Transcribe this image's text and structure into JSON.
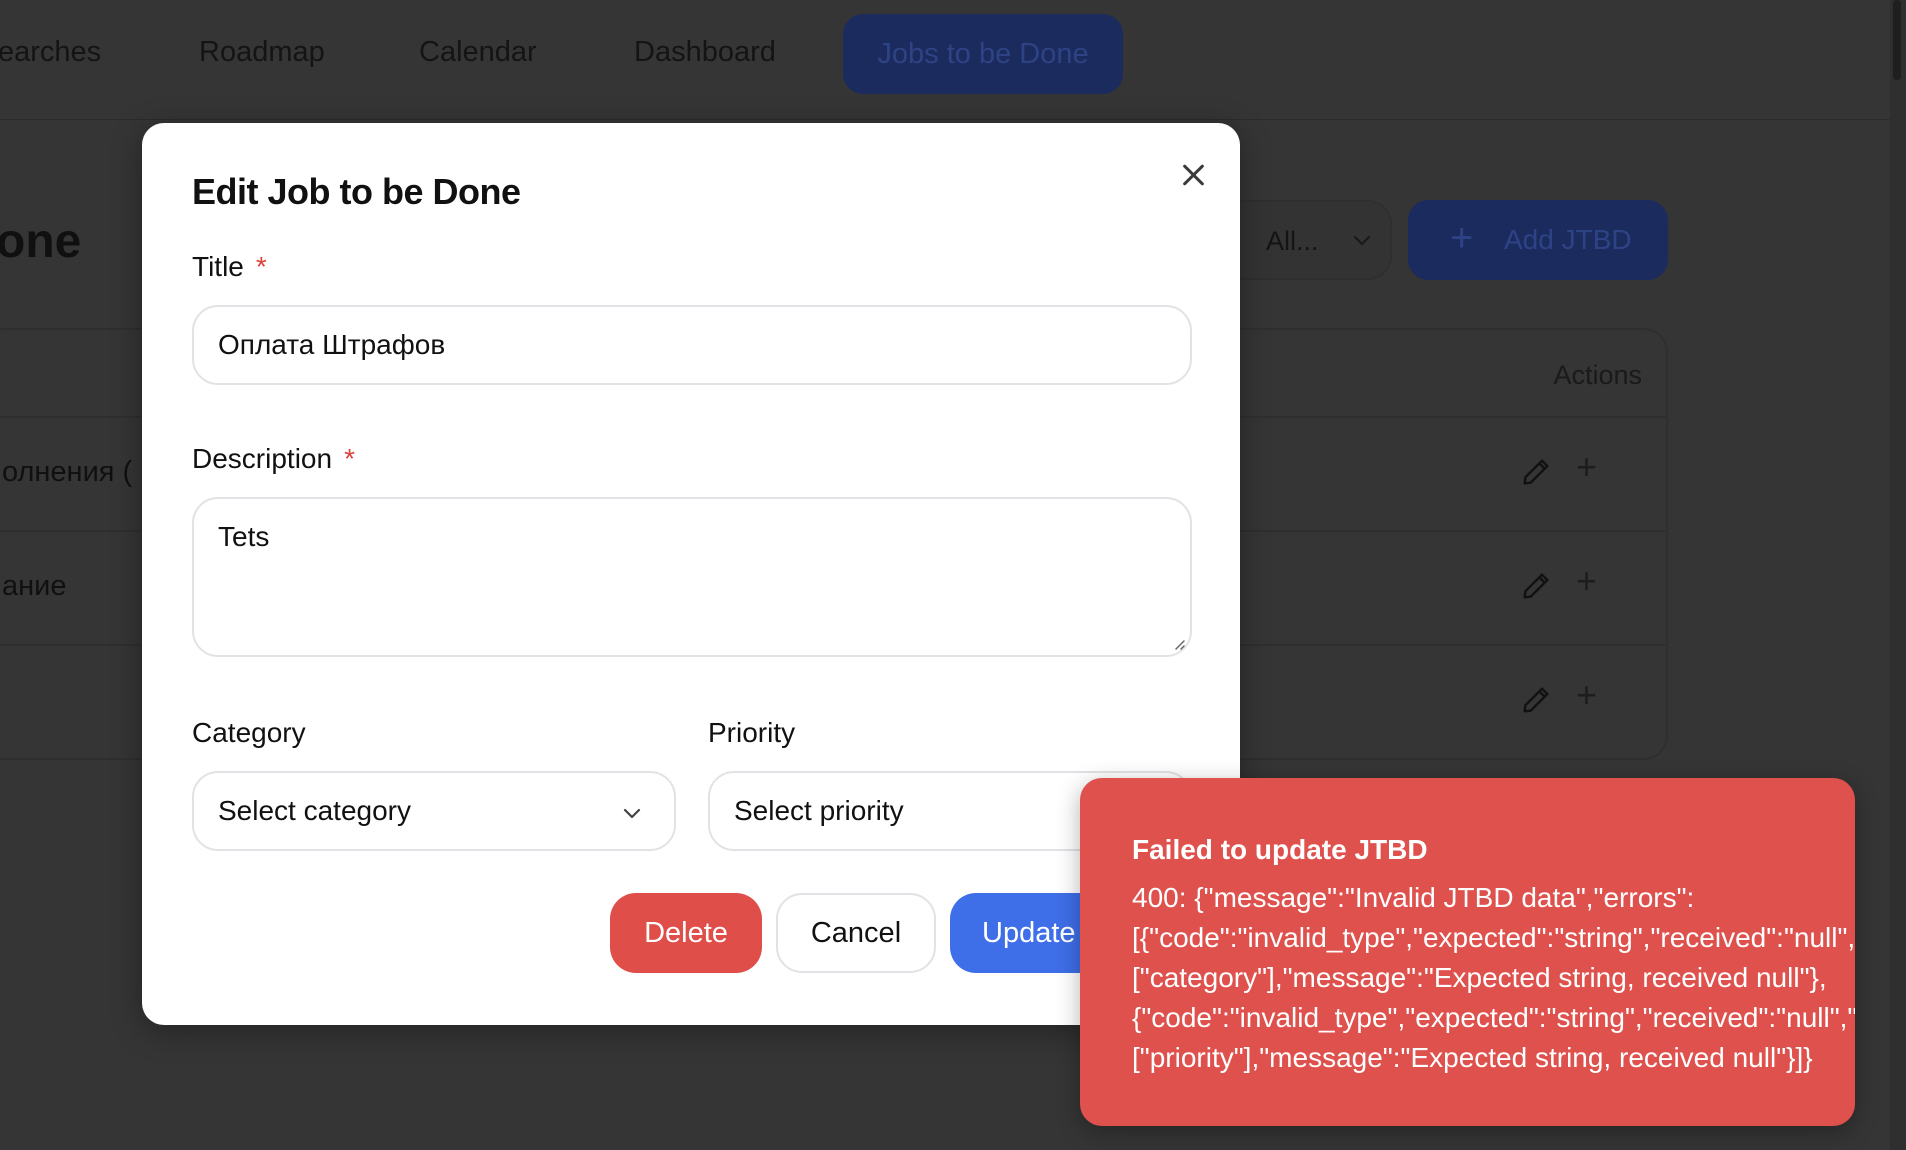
{
  "nav": {
    "items": [
      "earches",
      "Roadmap",
      "Calendar",
      "Dashboard"
    ],
    "active": "Jobs to be Done"
  },
  "background": {
    "page_title": "one",
    "filter_value": "All...",
    "add_button": "Add JTBD",
    "table": {
      "actions_header": "Actions",
      "rows": [
        "олнения (",
        "ание",
        ""
      ]
    }
  },
  "modal": {
    "title": "Edit Job to be Done",
    "fields": {
      "title_label": "Title",
      "title_value": "Оплата Штрафов",
      "description_label": "Description",
      "description_value": "Tets",
      "required_mark": "*",
      "category_label": "Category",
      "category_placeholder": "Select category",
      "priority_label": "Priority",
      "priority_placeholder": "Select priority"
    },
    "buttons": {
      "delete": "Delete",
      "cancel": "Cancel",
      "update": "Update"
    }
  },
  "toast": {
    "title": "Failed to update JTBD",
    "lines": [
      "400: {\"message\":\"Invalid JTBD data\",\"errors\":",
      "[{\"code\":\"invalid_type\",\"expected\":\"string\",\"received\":\"null\",\"path\":",
      "[\"category\"],\"message\":\"Expected string, received null\"},",
      "{\"code\":\"invalid_type\",\"expected\":\"string\",\"received\":\"null\",\"path\":",
      "[\"priority\"],\"message\":\"Expected string, received null\"}]}"
    ]
  },
  "colors": {
    "danger": "#df4e48",
    "primary": "#3e6ee8",
    "nav_active_bg": "#1c2b5e",
    "required": "#e0413a"
  },
  "icons": [
    "close-icon",
    "chevron-down-icon",
    "pencil-icon",
    "plus-icon",
    "resize-grip-icon"
  ]
}
